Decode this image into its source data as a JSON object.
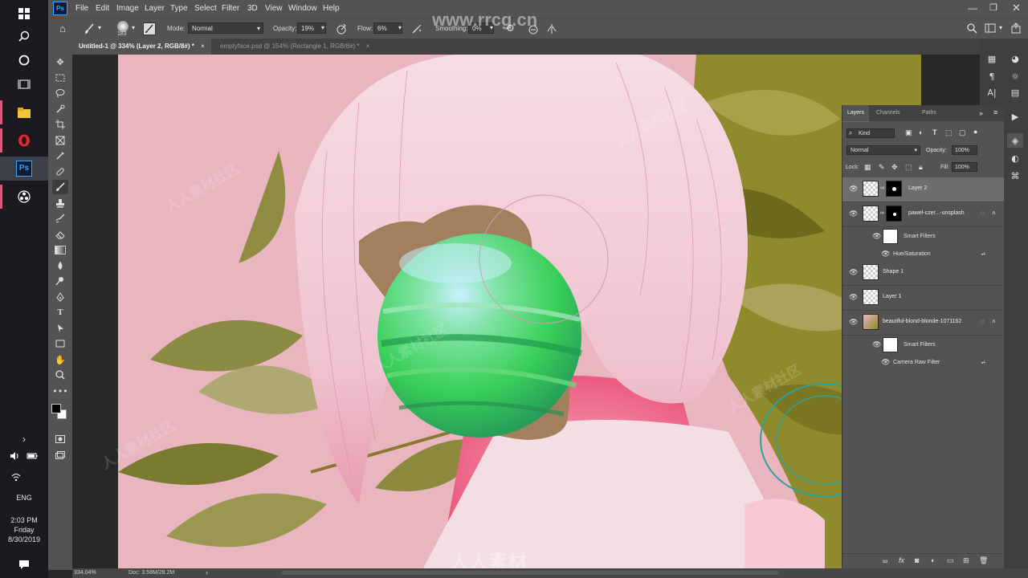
{
  "taskbar": {
    "clock": {
      "time": "2:03 PM",
      "day": "Friday",
      "date": "8/30/2019"
    },
    "language": "ENG",
    "chevron": "›"
  },
  "menu": {
    "app_badge": "Ps",
    "items": [
      "File",
      "Edit",
      "Image",
      "Layer",
      "Type",
      "Select",
      "Filter",
      "3D",
      "View",
      "Window",
      "Help"
    ]
  },
  "options": {
    "brush_size": "183",
    "mode_label": "Mode:",
    "mode_value": "Normal",
    "opacity_label": "Opacity:",
    "opacity_value": "19%",
    "flow_label": "Flow:",
    "flow_value": "6%",
    "smoothing_label": "Smoothing:",
    "smoothing_value": "0%"
  },
  "tabs": [
    {
      "label": "Untitled-1 @ 334% (Layer 2, RGB/8#) *",
      "close": "×"
    },
    {
      "label": "emptyface.psd @ 154% (Rectangle 1, RGB/8#) *",
      "close": "×"
    }
  ],
  "status": {
    "zoom": "334.04%",
    "doc": "Doc: 3.58M/28.2M",
    "arrow": "›"
  },
  "layers_panel": {
    "tabs": [
      "Layers",
      "Channels",
      "Paths"
    ],
    "filter_kind": "Kind",
    "blend_mode": "Normal",
    "opacity_label": "Opacity:",
    "opacity_value": "100%",
    "lock_label": "Lock:",
    "fill_label": "Fill:",
    "fill_value": "100%",
    "layers": [
      {
        "name": "Layer 2",
        "selected": true
      },
      {
        "name": "pawel-czer...-unsplash",
        "selected": false
      },
      {
        "name": "Smart Filters",
        "sub": true
      },
      {
        "name": "Hue/Saturation",
        "sub": true
      },
      {
        "name": "Shape 1",
        "selected": false
      },
      {
        "name": "Layer 1",
        "selected": false
      },
      {
        "name": "beautiful-blond-blonde-1071162",
        "selected": false
      },
      {
        "name": "Smart Filters",
        "sub": true
      },
      {
        "name": "Camera Raw Filter",
        "sub": true
      }
    ],
    "footer_fx": "fx"
  },
  "watermarks": {
    "site": "www.rrcg.cn",
    "brand": "人人素材",
    "tile": "人人素材社区"
  },
  "colors": {
    "ps_panel": "#535353",
    "canvas_pink": "#e9b5bf",
    "planet_green": "#3ed45a",
    "foliage": "#8f8a2c"
  }
}
